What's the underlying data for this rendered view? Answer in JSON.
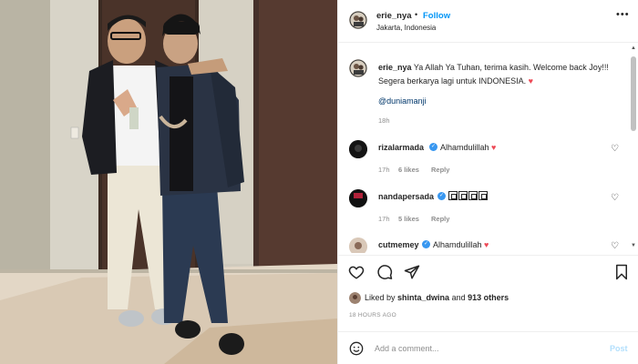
{
  "post": {
    "username": "erie_nya",
    "dot": "•",
    "follow_label": "Follow",
    "location": "Jakarta, Indonesia",
    "more_icon": "more-horizontal-icon"
  },
  "caption": {
    "username": "erie_nya",
    "text": "Ya Allah Ya Tuhan, terima kasih. Welcome back Joy!!! Segera berkarya lagi untuk INDONESIA.",
    "heart": "♥",
    "mention": "@duniamanji",
    "time": "18h"
  },
  "comments": [
    {
      "username": "rizalarmada",
      "text": "Alhamdulillah",
      "heart": "♥",
      "time": "17h",
      "likes": "6 likes",
      "reply": "Reply"
    },
    {
      "username": "nandapersada",
      "text": "",
      "emoji_boxes": 4,
      "time": "17h",
      "likes": "5 likes",
      "reply": "Reply"
    },
    {
      "username": "cutmemey",
      "text": "Alhamdulillah",
      "heart": "♥"
    }
  ],
  "verified_mark": "✓",
  "actions": [
    "heart-icon",
    "comment-icon",
    "share-icon",
    "save-icon"
  ],
  "likes": {
    "prefix": "Liked by",
    "user": "shinta_dwina",
    "conj": "and",
    "others": "913 others"
  },
  "timestamp": "18 HOURS AGO",
  "add_comment": {
    "placeholder": "Add a comment...",
    "post_label": "Post"
  },
  "scroll": {
    "up": "▲",
    "down": "▼"
  },
  "colors": {
    "accent": "#0095f6",
    "heart": "#ed4956",
    "verified": "#3897f0",
    "muted": "#8e8e8e"
  }
}
